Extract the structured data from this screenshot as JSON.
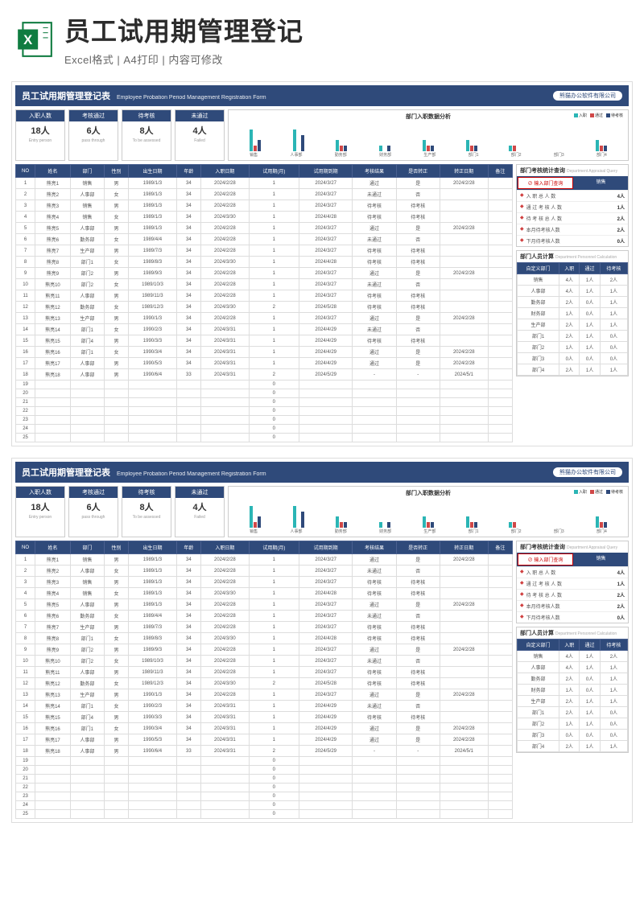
{
  "banner": {
    "title": "员工试用期管理登记",
    "sub": "Excel格式 | A4打印 | 内容可修改"
  },
  "sheet": {
    "title_cn": "员工试用期管理登记表",
    "title_en": "Employee Probation Period Management Registration Form",
    "company": "熊猫办公软件有限公司"
  },
  "stats": [
    {
      "label": "入职人数",
      "val": "18人",
      "en": "Entry person"
    },
    {
      "label": "考核通过",
      "val": "6人",
      "en": "pass through"
    },
    {
      "label": "待考核",
      "val": "8人",
      "en": "To be assessed"
    },
    {
      "label": "未通过",
      "val": "4人",
      "en": "Failed"
    }
  ],
  "chart_data": {
    "type": "bar",
    "title": "部门入职数据分析",
    "categories": [
      "销售",
      "人事部",
      "勤务部",
      "财务部",
      "生产部",
      "部门1",
      "部门2",
      "部门3",
      "部门4"
    ],
    "series": [
      {
        "name": "入职",
        "color": "#2bb5b5",
        "values": [
          4,
          4,
          2,
          1,
          2,
          2,
          1,
          0,
          2
        ]
      },
      {
        "name": "通过",
        "color": "#d04848",
        "values": [
          1,
          0,
          1,
          0,
          1,
          1,
          1,
          0,
          1
        ]
      },
      {
        "name": "待考核",
        "color": "#2f4a7a",
        "values": [
          2,
          3,
          1,
          1,
          1,
          1,
          0,
          0,
          1
        ]
      }
    ],
    "ylim": [
      0,
      5
    ]
  },
  "table": {
    "headers": [
      "NO",
      "姓名",
      "部门",
      "性别",
      "出生日期",
      "年龄",
      "入职日期",
      "试用期(月)",
      "试用期到期",
      "考核结果",
      "是否转正",
      "转正日期",
      "备注"
    ],
    "rows": [
      [
        "1",
        "熊亮1",
        "销售",
        "男",
        "1989/1/3",
        "34",
        "2024/2/28",
        "1",
        "2024/3/27",
        "通过",
        "是",
        "2024/2/28",
        ""
      ],
      [
        "2",
        "熊亮2",
        "人事部",
        "女",
        "1989/1/3",
        "34",
        "2024/2/28",
        "1",
        "2024/3/27",
        "未通过",
        "否",
        "",
        ""
      ],
      [
        "3",
        "熊亮3",
        "销售",
        "男",
        "1989/1/3",
        "34",
        "2024/2/28",
        "1",
        "2024/3/27",
        "待考核",
        "待考核",
        "",
        ""
      ],
      [
        "4",
        "熊亮4",
        "销售",
        "女",
        "1989/1/3",
        "34",
        "2024/3/30",
        "1",
        "2024/4/28",
        "待考核",
        "待考核",
        "",
        ""
      ],
      [
        "5",
        "熊亮5",
        "人事部",
        "男",
        "1989/1/3",
        "34",
        "2024/2/28",
        "1",
        "2024/3/27",
        "通过",
        "是",
        "2024/2/28",
        ""
      ],
      [
        "6",
        "熊亮6",
        "勤务部",
        "女",
        "1989/4/4",
        "34",
        "2024/2/28",
        "1",
        "2024/3/27",
        "未通过",
        "否",
        "",
        ""
      ],
      [
        "7",
        "熊亮7",
        "生产部",
        "男",
        "1989/7/3",
        "34",
        "2024/2/28",
        "1",
        "2024/3/27",
        "待考核",
        "待考核",
        "",
        ""
      ],
      [
        "8",
        "熊亮8",
        "部门1",
        "女",
        "1989/8/3",
        "34",
        "2024/3/30",
        "1",
        "2024/4/28",
        "待考核",
        "待考核",
        "",
        ""
      ],
      [
        "9",
        "熊亮9",
        "部门2",
        "男",
        "1989/9/3",
        "34",
        "2024/2/28",
        "1",
        "2024/3/27",
        "通过",
        "是",
        "2024/2/28",
        ""
      ],
      [
        "10",
        "熊亮10",
        "部门2",
        "女",
        "1989/10/3",
        "34",
        "2024/2/28",
        "1",
        "2024/3/27",
        "未通过",
        "否",
        "",
        ""
      ],
      [
        "11",
        "熊亮11",
        "人事部",
        "男",
        "1989/11/3",
        "34",
        "2024/2/28",
        "1",
        "2024/3/27",
        "待考核",
        "待考核",
        "",
        ""
      ],
      [
        "12",
        "熊亮12",
        "勤务部",
        "女",
        "1989/12/3",
        "34",
        "2024/3/30",
        "2",
        "2024/5/28",
        "待考核",
        "待考核",
        "",
        ""
      ],
      [
        "13",
        "熊亮13",
        "生产部",
        "男",
        "1990/1/3",
        "34",
        "2024/2/28",
        "1",
        "2024/3/27",
        "通过",
        "是",
        "2024/2/28",
        ""
      ],
      [
        "14",
        "熊亮14",
        "部门1",
        "女",
        "1990/2/3",
        "34",
        "2024/3/31",
        "1",
        "2024/4/29",
        "未通过",
        "否",
        "",
        ""
      ],
      [
        "15",
        "熊亮15",
        "部门4",
        "男",
        "1990/3/3",
        "34",
        "2024/3/31",
        "1",
        "2024/4/29",
        "待考核",
        "待考核",
        "",
        ""
      ],
      [
        "16",
        "熊亮16",
        "部门1",
        "女",
        "1990/3/4",
        "34",
        "2024/3/31",
        "1",
        "2024/4/29",
        "通过",
        "是",
        "2024/2/28",
        ""
      ],
      [
        "17",
        "熊亮17",
        "人事部",
        "男",
        "1990/5/3",
        "34",
        "2024/3/31",
        "1",
        "2024/4/29",
        "通过",
        "是",
        "2024/2/28",
        ""
      ],
      [
        "18",
        "熊亮18",
        "人事部",
        "男",
        "1990/6/4",
        "33",
        "2024/3/31",
        "2",
        "2024/5/29",
        "-",
        "-",
        "2024/5/1",
        ""
      ],
      [
        "19",
        "",
        "",
        "",
        "",
        "",
        "",
        "0",
        "",
        "",
        "",
        "",
        ""
      ],
      [
        "20",
        "",
        "",
        "",
        "",
        "",
        "",
        "0",
        "",
        "",
        "",
        "",
        ""
      ],
      [
        "21",
        "",
        "",
        "",
        "",
        "",
        "",
        "0",
        "",
        "",
        "",
        "",
        ""
      ],
      [
        "22",
        "",
        "",
        "",
        "",
        "",
        "",
        "0",
        "",
        "",
        "",
        "",
        ""
      ],
      [
        "23",
        "",
        "",
        "",
        "",
        "",
        "",
        "0",
        "",
        "",
        "",
        "",
        ""
      ],
      [
        "24",
        "",
        "",
        "",
        "",
        "",
        "",
        "0",
        "",
        "",
        "",
        "",
        ""
      ],
      [
        "25",
        "",
        "",
        "",
        "",
        "",
        "",
        "0",
        "",
        "",
        "",
        "",
        ""
      ]
    ]
  },
  "query": {
    "panel_title": "部门考核统计查询",
    "panel_en": "Department Appraisal Query",
    "input_label": "输入部门查询",
    "btn": "销售",
    "rows": [
      {
        "label": "入 职 总 人 数",
        "val": "4人"
      },
      {
        "label": "通 过 考 核 人 数",
        "val": "1人"
      },
      {
        "label": "待 考 核 总 人 数",
        "val": "2人"
      },
      {
        "label": "本月待考核人数",
        "val": "2人"
      },
      {
        "label": "下月待考核人数",
        "val": "0人"
      }
    ]
  },
  "calc": {
    "panel_title": "部门人员计算",
    "panel_en": "Department Personnel Calculation",
    "headers": [
      "自定义部门",
      "入职",
      "通过",
      "待考核"
    ],
    "rows": [
      [
        "销售",
        "4人",
        "1人",
        "2人"
      ],
      [
        "人事部",
        "4人",
        "1人",
        "1人"
      ],
      [
        "勤务部",
        "2人",
        "0人",
        "1人"
      ],
      [
        "财务部",
        "1人",
        "0人",
        "1人"
      ],
      [
        "生产部",
        "2人",
        "1人",
        "1人"
      ],
      [
        "部门1",
        "2人",
        "1人",
        "0人"
      ],
      [
        "部门2",
        "1人",
        "1人",
        "0人"
      ],
      [
        "部门3",
        "0人",
        "0人",
        "0人"
      ],
      [
        "部门4",
        "2人",
        "1人",
        "1人"
      ]
    ]
  }
}
